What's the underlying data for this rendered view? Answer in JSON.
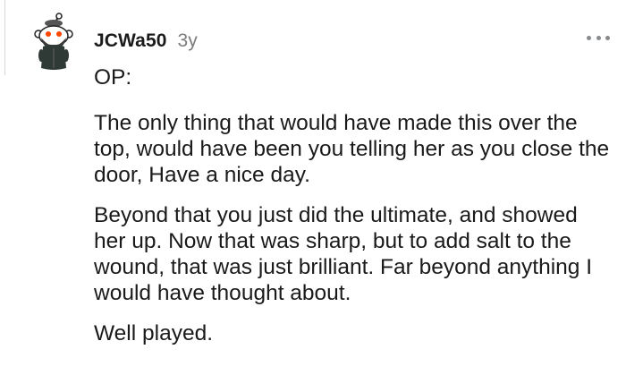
{
  "comment": {
    "username": "JCWa50",
    "age": "3y",
    "more_icon": "more-horizontal-icon",
    "avatar_icon": "snoo-avatar-icon",
    "paragraphs": [
      "OP:",
      "The only thing that would have made this over the top, would have been you telling her as you close the door, Have a nice day.",
      "Beyond that you just did the ultimate, and showed her up. Now that was sharp, but to add salt to the wound, that was just brilliant. Far beyond anything I would have thought about.",
      "Well played."
    ]
  },
  "colors": {
    "text": "#1a1a1b",
    "meta": "#7c7c7c",
    "icon": "#878a8c",
    "thread_line": "#d7d7d7"
  }
}
